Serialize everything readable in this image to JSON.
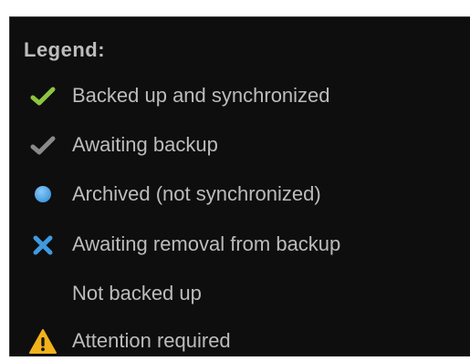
{
  "legend": {
    "title": "Legend:",
    "items": [
      {
        "label": "Backed up and synchronized",
        "icon": "green-checkmark-icon"
      },
      {
        "label": "Awaiting backup",
        "icon": "gray-checkmark-icon"
      },
      {
        "label": "Archived (not synchronized)",
        "icon": "blue-circle-icon"
      },
      {
        "label": "Awaiting removal from backup",
        "icon": "blue-x-icon"
      },
      {
        "label": "Not backed up",
        "icon": ""
      },
      {
        "label": "Attention required",
        "icon": "warning-triangle-icon"
      }
    ]
  },
  "colors": {
    "background": "#0e0e0e",
    "text": "#bcbcbc",
    "green_check": "#8cc63f",
    "gray_check": "#8a8a8a",
    "blue": "#3f9ae0",
    "warning": "#f2b21b"
  }
}
